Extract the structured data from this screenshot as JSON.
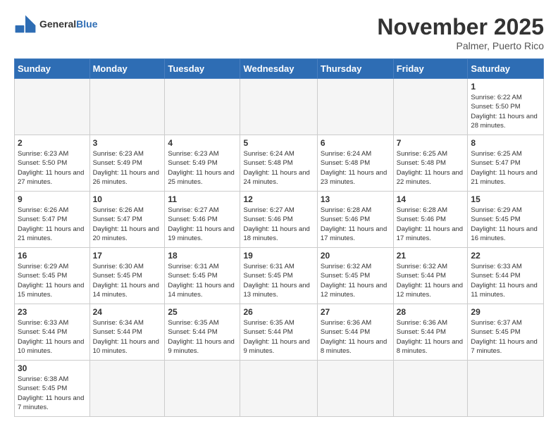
{
  "header": {
    "logo_general": "General",
    "logo_blue": "Blue",
    "month_title": "November 2025",
    "location": "Palmer, Puerto Rico"
  },
  "weekdays": [
    "Sunday",
    "Monday",
    "Tuesday",
    "Wednesday",
    "Thursday",
    "Friday",
    "Saturday"
  ],
  "days": [
    {
      "day": "",
      "info": ""
    },
    {
      "day": "",
      "info": ""
    },
    {
      "day": "",
      "info": ""
    },
    {
      "day": "",
      "info": ""
    },
    {
      "day": "",
      "info": ""
    },
    {
      "day": "",
      "info": ""
    },
    {
      "day": "1",
      "info": "Sunrise: 6:22 AM\nSunset: 5:50 PM\nDaylight: 11 hours\nand 28 minutes."
    },
    {
      "day": "2",
      "info": "Sunrise: 6:23 AM\nSunset: 5:50 PM\nDaylight: 11 hours\nand 27 minutes."
    },
    {
      "day": "3",
      "info": "Sunrise: 6:23 AM\nSunset: 5:49 PM\nDaylight: 11 hours\nand 26 minutes."
    },
    {
      "day": "4",
      "info": "Sunrise: 6:23 AM\nSunset: 5:49 PM\nDaylight: 11 hours\nand 25 minutes."
    },
    {
      "day": "5",
      "info": "Sunrise: 6:24 AM\nSunset: 5:48 PM\nDaylight: 11 hours\nand 24 minutes."
    },
    {
      "day": "6",
      "info": "Sunrise: 6:24 AM\nSunset: 5:48 PM\nDaylight: 11 hours\nand 23 minutes."
    },
    {
      "day": "7",
      "info": "Sunrise: 6:25 AM\nSunset: 5:48 PM\nDaylight: 11 hours\nand 22 minutes."
    },
    {
      "day": "8",
      "info": "Sunrise: 6:25 AM\nSunset: 5:47 PM\nDaylight: 11 hours\nand 21 minutes."
    },
    {
      "day": "9",
      "info": "Sunrise: 6:26 AM\nSunset: 5:47 PM\nDaylight: 11 hours\nand 21 minutes."
    },
    {
      "day": "10",
      "info": "Sunrise: 6:26 AM\nSunset: 5:47 PM\nDaylight: 11 hours\nand 20 minutes."
    },
    {
      "day": "11",
      "info": "Sunrise: 6:27 AM\nSunset: 5:46 PM\nDaylight: 11 hours\nand 19 minutes."
    },
    {
      "day": "12",
      "info": "Sunrise: 6:27 AM\nSunset: 5:46 PM\nDaylight: 11 hours\nand 18 minutes."
    },
    {
      "day": "13",
      "info": "Sunrise: 6:28 AM\nSunset: 5:46 PM\nDaylight: 11 hours\nand 17 minutes."
    },
    {
      "day": "14",
      "info": "Sunrise: 6:28 AM\nSunset: 5:46 PM\nDaylight: 11 hours\nand 17 minutes."
    },
    {
      "day": "15",
      "info": "Sunrise: 6:29 AM\nSunset: 5:45 PM\nDaylight: 11 hours\nand 16 minutes."
    },
    {
      "day": "16",
      "info": "Sunrise: 6:29 AM\nSunset: 5:45 PM\nDaylight: 11 hours\nand 15 minutes."
    },
    {
      "day": "17",
      "info": "Sunrise: 6:30 AM\nSunset: 5:45 PM\nDaylight: 11 hours\nand 14 minutes."
    },
    {
      "day": "18",
      "info": "Sunrise: 6:31 AM\nSunset: 5:45 PM\nDaylight: 11 hours\nand 14 minutes."
    },
    {
      "day": "19",
      "info": "Sunrise: 6:31 AM\nSunset: 5:45 PM\nDaylight: 11 hours\nand 13 minutes."
    },
    {
      "day": "20",
      "info": "Sunrise: 6:32 AM\nSunset: 5:45 PM\nDaylight: 11 hours\nand 12 minutes."
    },
    {
      "day": "21",
      "info": "Sunrise: 6:32 AM\nSunset: 5:44 PM\nDaylight: 11 hours\nand 12 minutes."
    },
    {
      "day": "22",
      "info": "Sunrise: 6:33 AM\nSunset: 5:44 PM\nDaylight: 11 hours\nand 11 minutes."
    },
    {
      "day": "23",
      "info": "Sunrise: 6:33 AM\nSunset: 5:44 PM\nDaylight: 11 hours\nand 10 minutes."
    },
    {
      "day": "24",
      "info": "Sunrise: 6:34 AM\nSunset: 5:44 PM\nDaylight: 11 hours\nand 10 minutes."
    },
    {
      "day": "25",
      "info": "Sunrise: 6:35 AM\nSunset: 5:44 PM\nDaylight: 11 hours\nand 9 minutes."
    },
    {
      "day": "26",
      "info": "Sunrise: 6:35 AM\nSunset: 5:44 PM\nDaylight: 11 hours\nand 9 minutes."
    },
    {
      "day": "27",
      "info": "Sunrise: 6:36 AM\nSunset: 5:44 PM\nDaylight: 11 hours\nand 8 minutes."
    },
    {
      "day": "28",
      "info": "Sunrise: 6:36 AM\nSunset: 5:44 PM\nDaylight: 11 hours\nand 8 minutes."
    },
    {
      "day": "29",
      "info": "Sunrise: 6:37 AM\nSunset: 5:45 PM\nDaylight: 11 hours\nand 7 minutes."
    },
    {
      "day": "30",
      "info": "Sunrise: 6:38 AM\nSunset: 5:45 PM\nDaylight: 11 hours\nand 7 minutes."
    },
    {
      "day": "",
      "info": ""
    },
    {
      "day": "",
      "info": ""
    },
    {
      "day": "",
      "info": ""
    },
    {
      "day": "",
      "info": ""
    },
    {
      "day": "",
      "info": ""
    },
    {
      "day": "",
      "info": ""
    }
  ]
}
